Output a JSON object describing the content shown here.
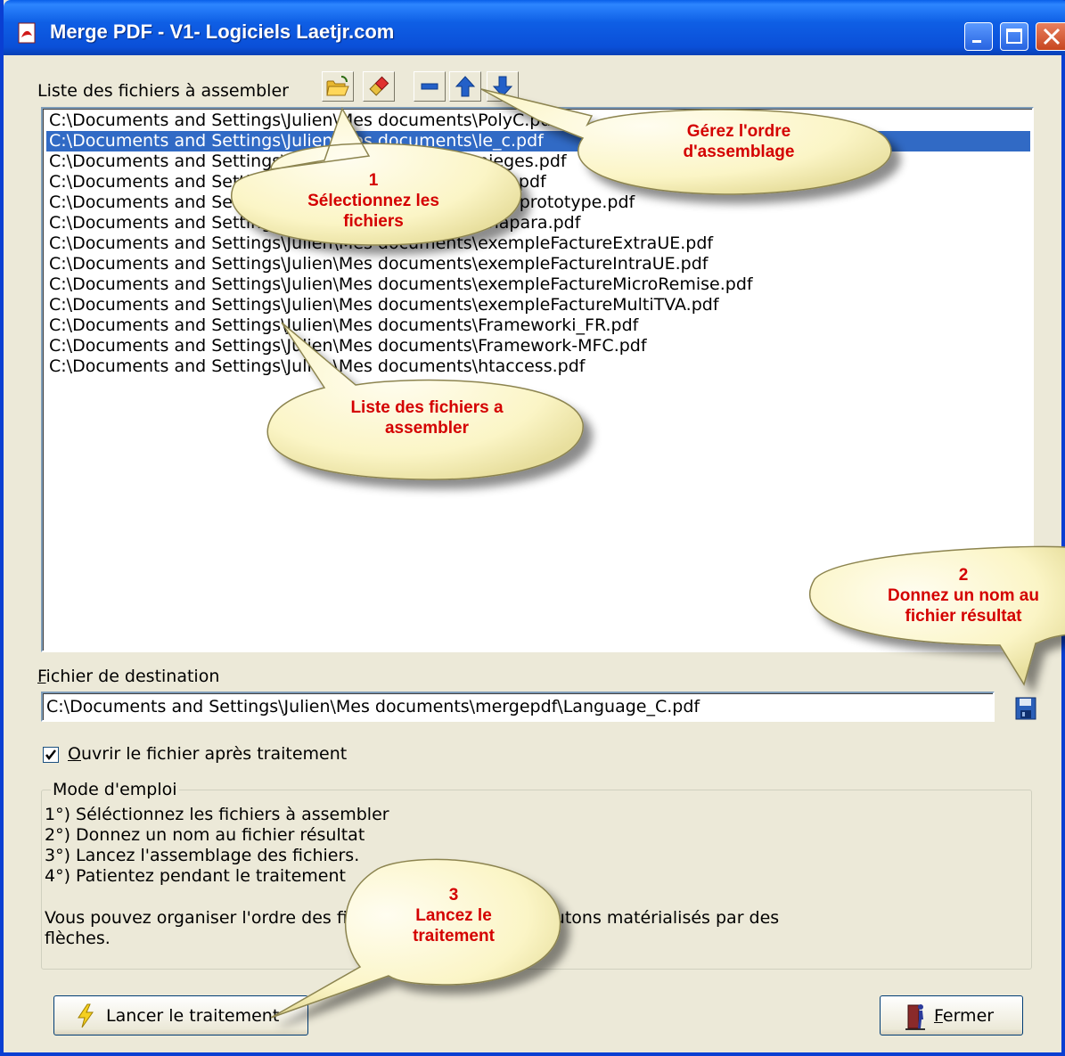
{
  "window": {
    "title": "Merge PDF - V1- Logiciels Laetjr.com"
  },
  "files_section": {
    "label": "Liste des fichiers à assembler",
    "toolbar_icons": [
      "folder-open-icon",
      "eraser-icon",
      "minus-icon",
      "arrow-up-icon",
      "arrow-down-icon"
    ]
  },
  "file_list": [
    "C:\\Documents and Settings\\Julien\\Mes documents\\PolyC.pdf",
    "C:\\Documents and Settings\\Julien\\Mes documents\\le_c.pdf",
    "C:\\Documents and Settings\\Julien\\Mes documents\\pieges.pdf",
    "C:\\Documents and Settings\\Julien\\Mes documents\\ajax.pdf",
    "C:\\Documents and Settings\\Julien\\Mes documents\\ajax-prototype.pdf",
    "C:\\Documents and Settings\\Julien\\Mes documents\\anapara.pdf",
    "C:\\Documents and Settings\\Julien\\Mes documents\\exempleFactureExtraUE.pdf",
    "C:\\Documents and Settings\\Julien\\Mes documents\\exempleFactureIntraUE.pdf",
    "C:\\Documents and Settings\\Julien\\Mes documents\\exempleFactureMicroRemise.pdf",
    "C:\\Documents and Settings\\Julien\\Mes documents\\exempleFactureMultiTVA.pdf",
    "C:\\Documents and Settings\\Julien\\Mes documents\\Frameworki_FR.pdf",
    "C:\\Documents and Settings\\Julien\\Mes documents\\Framework-MFC.pdf",
    "C:\\Documents and Settings\\Julien\\Mes documents\\htaccess.pdf"
  ],
  "selected_index": 1,
  "destination": {
    "label_first": "F",
    "label_rest": "ichier de destination",
    "value": "C:\\Documents and Settings\\Julien\\Mes documents\\mergepdf\\Language_C.pdf"
  },
  "open_after": {
    "checked": true,
    "label_first": "O",
    "label_rest": "uvrir le fichier après traitement"
  },
  "instructions": {
    "legend": "Mode d'emploi",
    "lines": [
      "1°) Séléctionnez les fichiers à assembler",
      "2°) Donnez un nom au fichier résultat",
      "3°) Lancez l'assemblage des fichiers.",
      "4°) Patientez pendant le traitement"
    ],
    "note_line1": "Vous pouvez organiser l'ordre des fichiers en utilisant les boutons matérialisés par des",
    "note_line2": "flèches."
  },
  "buttons": {
    "run": "Lancer le traitement",
    "close_first": "F",
    "close_rest": "ermer"
  },
  "callouts": {
    "select": [
      "1",
      "Sélectionnez les",
      "fichiers"
    ],
    "order": [
      "Gérez l'ordre",
      "d'assemblage"
    ],
    "list": [
      "Liste des fichiers a",
      "assembler"
    ],
    "name": [
      "2",
      "Donnez un nom au",
      "fichier résultat"
    ],
    "run": [
      "3",
      "Lancez le",
      "traitement"
    ]
  },
  "colors": {
    "selection": "#316ac5",
    "callout_text": "#d40000",
    "callout_fill": "#fbf5c6"
  }
}
